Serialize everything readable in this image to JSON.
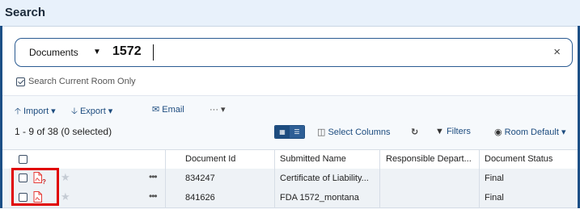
{
  "window": {
    "title": "Search"
  },
  "search": {
    "scope_label": "Documents",
    "scope_arrow": "▼",
    "query": "1572",
    "clear_glyph": "×"
  },
  "options": {
    "search_current_room_only": "Search Current Room Only",
    "search_current_room_only_checked": true
  },
  "toolbar": {
    "import": "🡡 Import ▾",
    "export": "🡣 Export ▾",
    "email": "✉ Email",
    "more": "··· ▾"
  },
  "results": {
    "count_text": "1 - 9 of 38 (0 selected)",
    "select_columns": "Select Columns",
    "refresh_glyph": "↻",
    "filters": "Filters",
    "room_default": "Room Default ▾"
  },
  "table": {
    "columns": [
      "Document Id",
      "Submitted Name",
      "Responsible Depart...",
      "Document Status"
    ],
    "rows": [
      {
        "document_id": "834247",
        "submitted_name": "Certificate of Liability...",
        "responsible_department": "",
        "document_status": "Final",
        "has_question_badge": true
      },
      {
        "document_id": "841626",
        "submitted_name": "FDA 1572_montana",
        "responsible_department": "",
        "document_status": "Final",
        "has_question_badge": false
      }
    ]
  },
  "icons": {
    "pdf": "pdf-icon",
    "star": "star-icon",
    "more": "more-dots-icon",
    "grid_view": "grid-view-icon",
    "list_view": "list-view-icon",
    "columns": "columns-icon",
    "filter": "filter-icon",
    "eye": "eye-icon"
  },
  "colors": {
    "accent": "#1d4c7f",
    "highlight": "#e00000",
    "pdf_red": "#e53935"
  }
}
